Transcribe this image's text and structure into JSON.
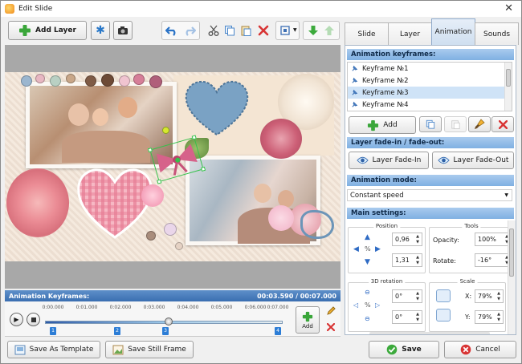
{
  "window": {
    "title": "Edit Slide"
  },
  "toolbar": {
    "add_layer": "Add Layer"
  },
  "tabs": [
    {
      "label": "Slide",
      "active": false
    },
    {
      "label": "Layer",
      "active": false
    },
    {
      "label": "Animation",
      "active": true
    },
    {
      "label": "Sounds",
      "active": false
    }
  ],
  "timeline": {
    "title": "Animation Keyframes:",
    "time": "00:03.590 / 00:07.000",
    "ticks": [
      "0:00.000",
      "0:01.000",
      "0:02.000",
      "0:03.000",
      "0:04.000",
      "0:05.000",
      "0:06.000",
      "0:07.000"
    ],
    "keyframes": [
      "1",
      "2",
      "3",
      "4"
    ],
    "keyframe_times": [
      0.0,
      2.0,
      3.5,
      7.0
    ],
    "playhead_time": 3.59,
    "duration": 7.0,
    "add_label": "Add"
  },
  "animation_panel": {
    "keyframes_header": "Animation keyframes:",
    "keyframes": [
      "Keyframe №1",
      "Keyframe №2",
      "Keyframe №3",
      "Keyframe №4"
    ],
    "selected_index": 2,
    "add_button": "Add",
    "fade_header": "Layer fade-in / fade-out:",
    "fade_in": "Layer Fade-In",
    "fade_out": "Layer Fade-Out",
    "mode_header": "Animation mode:",
    "mode_value": "Constant speed",
    "main_header": "Main settings:",
    "position_label": "Position",
    "pos_x": "0,96",
    "pos_y": "1,31",
    "tools_label": "Tools",
    "opacity_label": "Opacity:",
    "opacity_value": "100%",
    "rotate_label": "Rotate:",
    "rotate_value": "-16°",
    "rotation3d_label": "3D rotation",
    "rot3d_x": "0°",
    "rot3d_y": "0°",
    "scale_label": "Scale",
    "scale_x_label": "X:",
    "scale_x": "79%",
    "scale_y_label": "Y:",
    "scale_y": "79%"
  },
  "footer": {
    "save_template": "Save As Template",
    "save_still": "Save Still Frame",
    "save": "Save",
    "cancel": "Cancel"
  }
}
